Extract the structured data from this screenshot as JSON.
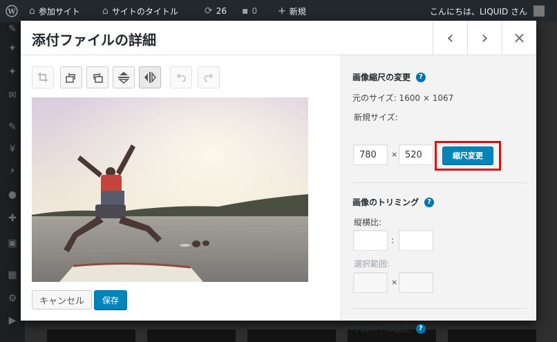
{
  "admin_bar": {
    "site_label": "参加サイト",
    "site_title": "サイトのタイトル",
    "updates_count": "26",
    "comments_count": "0",
    "new_label": "新規",
    "greeting": "こんにちは、LIQUID さん"
  },
  "modal": {
    "title": "添付ファイルの詳細",
    "prev_icon": "‹",
    "next_icon": "›",
    "close_icon": "×"
  },
  "editor": {
    "tools": [
      "crop-icon",
      "rotate-left-icon",
      "rotate-right-icon",
      "flip-vertical-icon",
      "flip-horizontal-icon",
      "undo-icon",
      "redo-icon"
    ],
    "cancel_label": "キャンセル",
    "save_label": "保存"
  },
  "panel": {
    "scale": {
      "heading": "画像縮尺の変更",
      "original_size": "元のサイズ: 1600 × 1067",
      "new_size_label": "新規サイズ:",
      "width": "780",
      "height": "520",
      "times": "×",
      "scale_button": "縮尺変更"
    },
    "crop": {
      "heading": "画像のトリミング",
      "aspect_label": "縦横比:",
      "aspect_sep": ":",
      "selection_label": "選択範囲:",
      "selection_sep": "×"
    },
    "thumbnail": {
      "heading": "サムネイル設定"
    },
    "help": "?"
  },
  "colors": {
    "accent": "#0085ba",
    "highlight": "#e20b0b",
    "admin_bar": "#23282d"
  }
}
